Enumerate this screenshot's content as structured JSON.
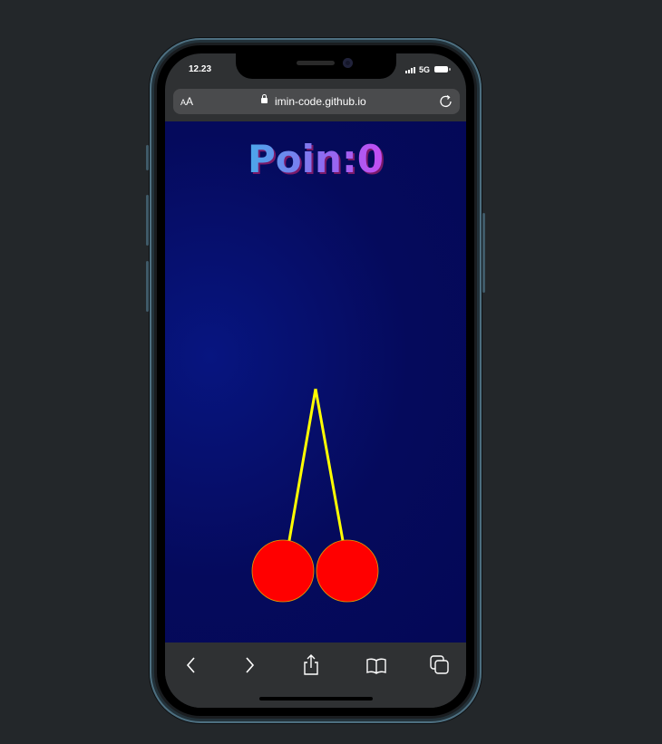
{
  "status_bar": {
    "time": "12.23",
    "network": "5G"
  },
  "browser": {
    "text_size_label_small": "A",
    "text_size_label_large": "A",
    "url": "imin-code.github.io",
    "icons": [
      "lock-icon",
      "reload-icon",
      "back-icon",
      "forward-icon",
      "share-icon",
      "bookmarks-icon",
      "tabs-icon"
    ]
  },
  "game": {
    "score_label": "Poin:",
    "score_value": "0",
    "score_text": "Poin:0",
    "colors": {
      "background": "#050a5c",
      "stem": "#ffff00",
      "cherry": "#ff0000",
      "cherry_outline": "#e0a000",
      "score_gradient_start": "#4aa8ea",
      "score_gradient_end": "#c44df2"
    }
  }
}
